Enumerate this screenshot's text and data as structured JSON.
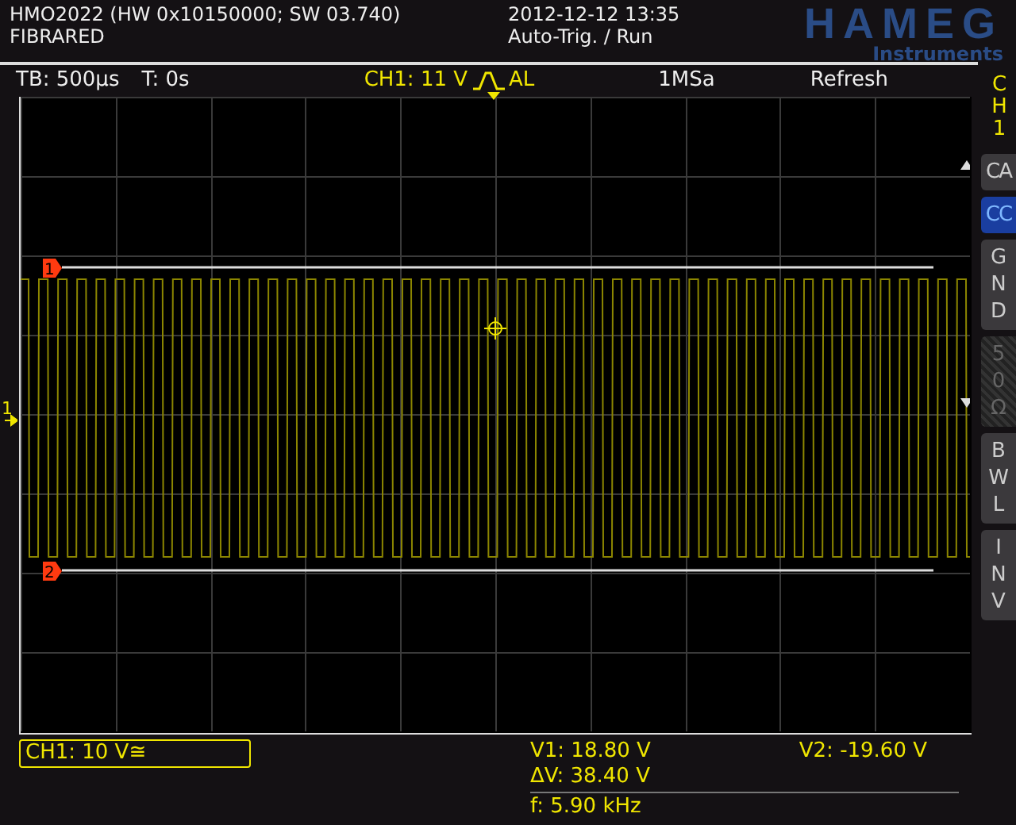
{
  "header": {
    "model": "HMO2022 (HW 0x10150000; SW 03.740)",
    "name": "FIBRARED",
    "datetime": "2012-12-12 13:35",
    "trigger_mode": "Auto-Trig. / Run",
    "logo": "HAMEG",
    "logo_sub": "Instruments"
  },
  "info_bar": {
    "timebase": "TB: 500µs",
    "trigger_time": "T: 0s",
    "trigger_channel": "CH1: 11 V",
    "trigger_coupling": "AL",
    "sample_rate": "1MSa",
    "mode": "Refresh"
  },
  "plot": {
    "channel_marker": "1",
    "cursors": [
      {
        "label": "1"
      },
      {
        "label": "2"
      }
    ]
  },
  "side_menu": {
    "title": "CH1",
    "buttons": [
      {
        "label": "CA",
        "selected": false,
        "disabled": false
      },
      {
        "label": "CC",
        "selected": true,
        "disabled": false
      },
      {
        "label": "GND",
        "selected": false,
        "disabled": false
      },
      {
        "label": "50Ω",
        "selected": false,
        "disabled": true
      },
      {
        "label": "BWL",
        "selected": false,
        "disabled": false
      },
      {
        "label": "INV",
        "selected": false,
        "disabled": false
      }
    ]
  },
  "bottom": {
    "channel_info": "CH1: 10 V≅",
    "measurements": {
      "v1": "V1: 18.80 V",
      "v2": "V2: -19.60 V",
      "delta_v": "ΔV: 38.40 V",
      "frequency": "f: 5.90 kHz"
    }
  }
}
